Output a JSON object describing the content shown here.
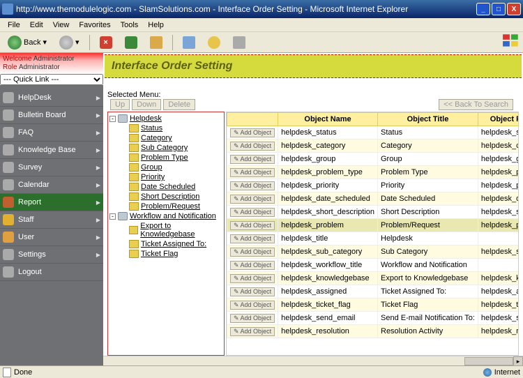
{
  "window": {
    "title": "http://www.themodulelogic.com - SlamSolutions.com - Interface Order Setting - Microsoft Internet Explorer"
  },
  "menubar": {
    "items": [
      "File",
      "Edit",
      "View",
      "Favorites",
      "Tools",
      "Help"
    ]
  },
  "toolbar": {
    "back_label": "Back"
  },
  "welcome": {
    "label1": "Welcome",
    "val1": "Administrator",
    "label2": "Role",
    "val2": "Administrator"
  },
  "quicklink": {
    "selected": "--- Quick Link ---"
  },
  "sidebar": {
    "items": [
      {
        "label": "HelpDesk"
      },
      {
        "label": "Bulletin Board"
      },
      {
        "label": "FAQ"
      },
      {
        "label": "Knowledge Base"
      },
      {
        "label": "Survey"
      },
      {
        "label": "Calendar"
      },
      {
        "label": "Report",
        "active": true
      },
      {
        "label": "Staff"
      },
      {
        "label": "User"
      },
      {
        "label": "Settings"
      },
      {
        "label": "Logout"
      }
    ]
  },
  "page": {
    "title": "Interface Order Setting",
    "selected_menu_label": "Selected Menu:",
    "up_label": "Up",
    "down_label": "Down",
    "delete_label": "Delete",
    "back_to_search_label": "<< Back To Search"
  },
  "tree": {
    "roots": [
      {
        "label": "Helpdesk",
        "children": [
          "Status",
          "Category",
          "Sub Category",
          "Problem Type",
          "Group",
          "Priority",
          "Date Scheduled",
          "Short Description",
          "Problem/Request"
        ]
      },
      {
        "label": "Workflow and Notification",
        "children": [
          "Export to Knowledgebase",
          "Ticket Assigned To:",
          "Ticket Flag"
        ]
      }
    ]
  },
  "grid": {
    "headers": {
      "c0": "",
      "c1": "Object Name",
      "c2": "Object Title",
      "c3": "Object Field Name"
    },
    "add_label": "Add Object",
    "rows": [
      {
        "name": "helpdesk_status",
        "title": "Status",
        "field": "helpdesk_status"
      },
      {
        "name": "helpdesk_category",
        "title": "Category",
        "field": "helpdesk_category"
      },
      {
        "name": "helpdesk_group",
        "title": "Group",
        "field": "helpdesk_group"
      },
      {
        "name": "helpdesk_problem_type",
        "title": "Problem Type",
        "field": "helpdesk_problem_type"
      },
      {
        "name": "helpdesk_priority",
        "title": "Priority",
        "field": "helpdesk_priority"
      },
      {
        "name": "helpdesk_date_scheduled",
        "title": "Date Scheduled",
        "field": "helpdesk_date_schedule"
      },
      {
        "name": "helpdesk_short_description",
        "title": "Short Description",
        "field": "helpdesk_short_descript"
      },
      {
        "name": "helpdesk_problem",
        "title": "Problem/Request",
        "field": "helpdesk_problem",
        "sel": true
      },
      {
        "name": "helpdesk_title",
        "title": "Helpdesk",
        "field": ""
      },
      {
        "name": "helpdesk_sub_category",
        "title": "Sub Category",
        "field": "helpdesk_sub_category"
      },
      {
        "name": "helpdesk_workflow_title",
        "title": "Workflow and Notification",
        "field": ""
      },
      {
        "name": "helpdesk_knowledgebase",
        "title": "Export to Knowledgebase",
        "field": "helpdesk_knowledgebas"
      },
      {
        "name": "helpdesk_assigned",
        "title": "Ticket Assigned To:",
        "field": "helpdesk_assigned"
      },
      {
        "name": "helpdesk_ticket_flag",
        "title": "Ticket Flag",
        "field": "helpdesk_ticket_flag"
      },
      {
        "name": "helpdesk_send_email",
        "title": "Send E-mail Notification To:",
        "field": "helpdesk_send_email"
      },
      {
        "name": "helpdesk_resolution",
        "title": "Resolution Activity",
        "field": "helpdesk_resolution"
      }
    ]
  },
  "statusbar": {
    "status": "Done",
    "zone": "Internet"
  }
}
